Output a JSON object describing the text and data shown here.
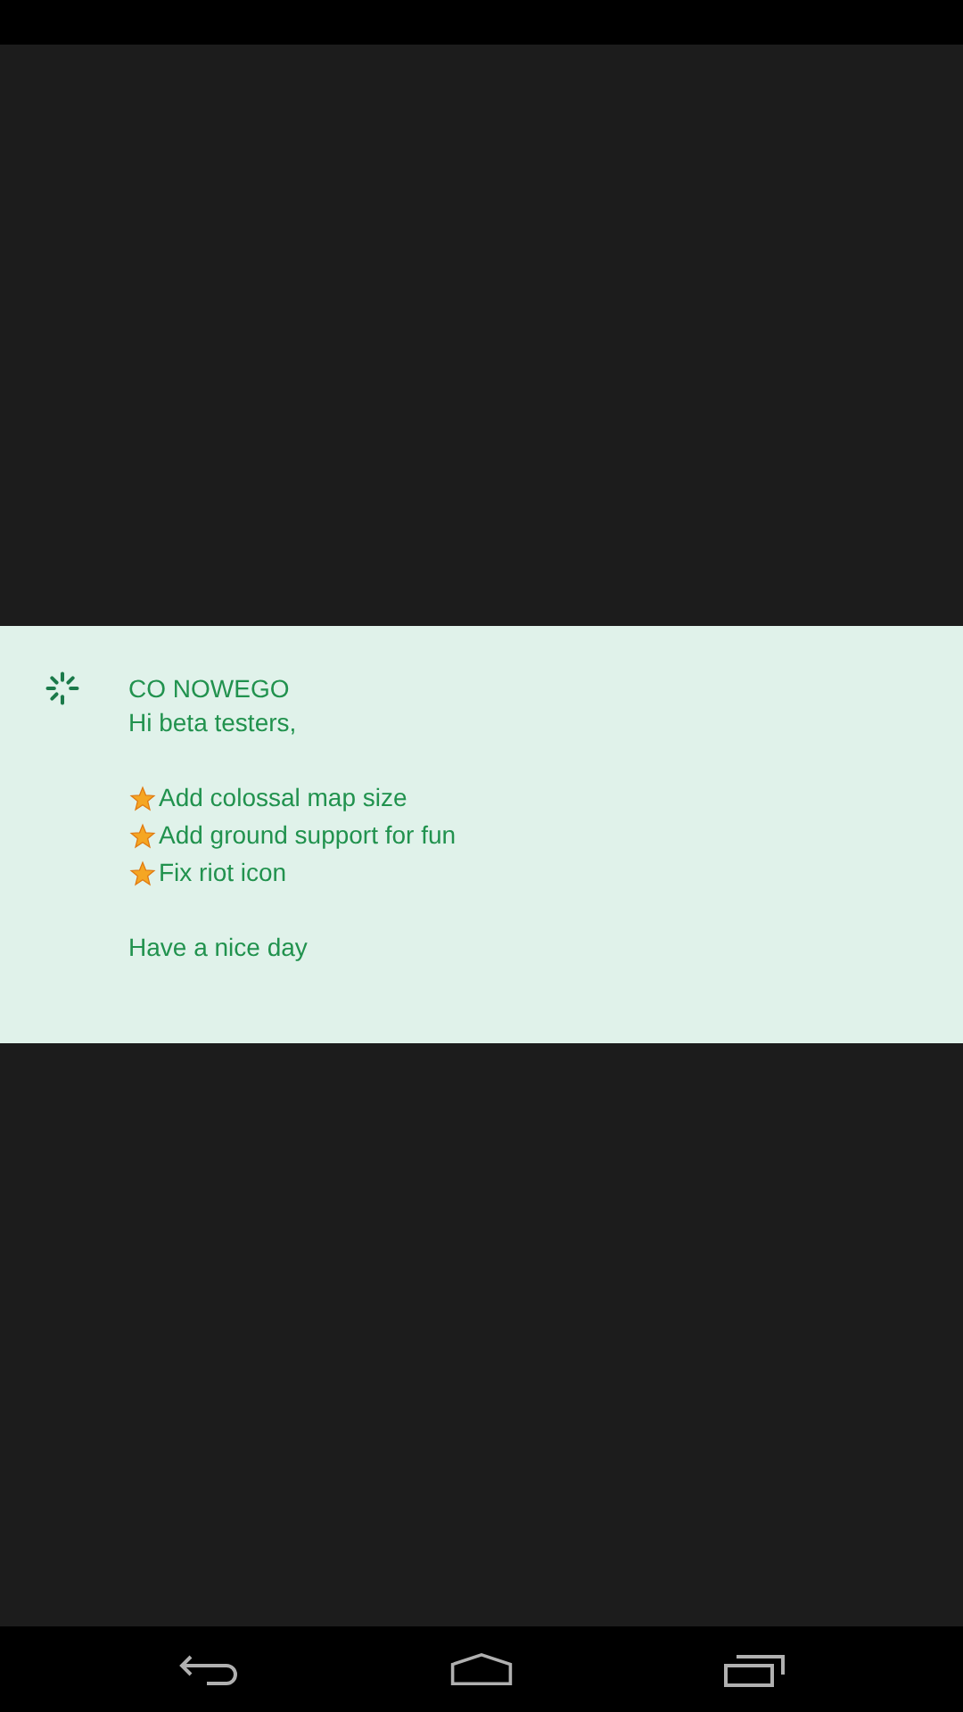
{
  "notice": {
    "title": "CO NOWEGO",
    "greeting": "Hi beta testers,",
    "bullets": [
      "Add colossal map size",
      "Add ground support for fun",
      "Fix riot icon"
    ],
    "closing": "Have a nice day"
  }
}
